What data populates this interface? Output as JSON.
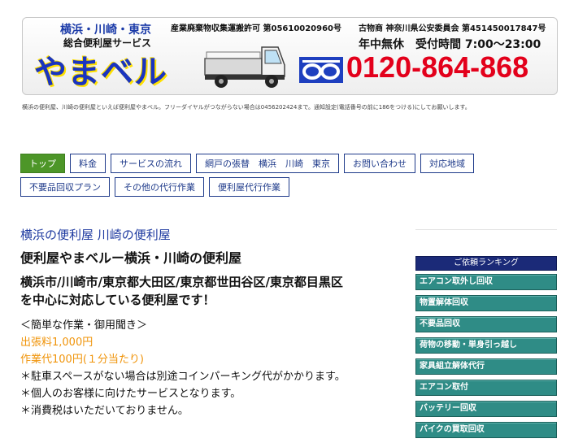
{
  "banner": {
    "cities": "横浜・川崎・東京",
    "permit": "産業廃棄物収集運搬許可 第05610020960号",
    "store": "古物商 神奈川県公安委員会 第451450017847号",
    "service": "総合便利屋サービス",
    "logo": "やまベル",
    "hours": "年中無休　受付時間 7:00～23:00",
    "phone": "0120-864-868",
    "colors": {
      "logo": "#1a34c0",
      "phone": "#e3001b"
    }
  },
  "subnote": "横浜の便利屋、川崎の便利屋といえば便利屋やまベル。フリーダイヤルがつながらない場合は0456202424まで。通知設定(電話番号の前に186をつける)にしてお願いします。",
  "nav": {
    "row1": [
      "トップ",
      "料金",
      "サービスの流れ",
      "網戸の張替　横浜　川崎　東京",
      "お問い合わせ",
      "対応地域"
    ],
    "row2": [
      "不要品回収プラン",
      "その他の代行作業",
      "便利屋代行作業"
    ]
  },
  "main": {
    "title": "横浜の便利屋 川崎の便利屋",
    "subtitle": "便利屋やまベルー横浜・川崎の便利屋",
    "areas_line1": "横浜市/川崎市/東京都大田区/東京都世田谷区/東京都目黒区",
    "areas_line2": "を中心に対応している便利屋です！",
    "section": "＜簡単な作業・御用聞き＞",
    "fee_trip": "出張料1,000円",
    "fee_work": "作業代100円(１分当たり)",
    "note1": "＊駐車スペースがない場合は別途コインパーキング代がかかります。",
    "note2": "＊個人のお客様に向けたサービスとなります。",
    "note3": "＊消費税はいただいておりません。"
  },
  "sidebar": {
    "heading": "ご依頼ランキング",
    "items": [
      "エアコン取外し回収",
      "物置解体回収",
      "不要品回収",
      "荷物の移動・単身引っ越し",
      "家具組立解体代行",
      "エアコン取付",
      "バッテリー回収",
      "バイクの買取回収"
    ]
  }
}
